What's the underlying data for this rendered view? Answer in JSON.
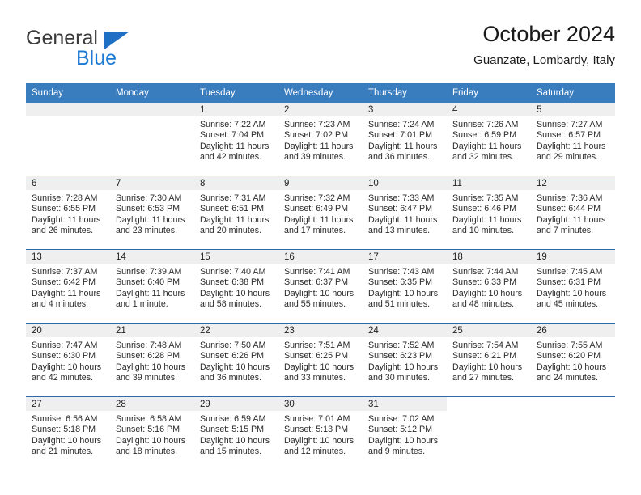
{
  "brand": {
    "name_top": "General",
    "name_bottom": "Blue",
    "accent_color": "#1c7ad4",
    "triangle_color": "#1f6fc4"
  },
  "header": {
    "title": "October 2024",
    "subtitle": "Guanzate, Lombardy, Italy"
  },
  "theme": {
    "header_row_color": "#3a7dbf",
    "row_divider_color": "#2a6ca8",
    "date_band_color": "#efefef"
  },
  "weekday_headers": [
    "Sunday",
    "Monday",
    "Tuesday",
    "Wednesday",
    "Thursday",
    "Friday",
    "Saturday"
  ],
  "weeks": [
    [
      {
        "date": "",
        "type": "blank",
        "sunrise": "",
        "sunset": "",
        "daylight_1": "",
        "daylight_2": ""
      },
      {
        "date": "",
        "type": "blank",
        "sunrise": "",
        "sunset": "",
        "daylight_1": "",
        "daylight_2": ""
      },
      {
        "date": "1",
        "type": "filled",
        "sunrise": "Sunrise: 7:22 AM",
        "sunset": "Sunset: 7:04 PM",
        "daylight_1": "Daylight: 11 hours",
        "daylight_2": "and 42 minutes."
      },
      {
        "date": "2",
        "type": "filled",
        "sunrise": "Sunrise: 7:23 AM",
        "sunset": "Sunset: 7:02 PM",
        "daylight_1": "Daylight: 11 hours",
        "daylight_2": "and 39 minutes."
      },
      {
        "date": "3",
        "type": "filled",
        "sunrise": "Sunrise: 7:24 AM",
        "sunset": "Sunset: 7:01 PM",
        "daylight_1": "Daylight: 11 hours",
        "daylight_2": "and 36 minutes."
      },
      {
        "date": "4",
        "type": "filled",
        "sunrise": "Sunrise: 7:26 AM",
        "sunset": "Sunset: 6:59 PM",
        "daylight_1": "Daylight: 11 hours",
        "daylight_2": "and 32 minutes."
      },
      {
        "date": "5",
        "type": "filled",
        "sunrise": "Sunrise: 7:27 AM",
        "sunset": "Sunset: 6:57 PM",
        "daylight_1": "Daylight: 11 hours",
        "daylight_2": "and 29 minutes."
      }
    ],
    [
      {
        "date": "6",
        "type": "filled",
        "sunrise": "Sunrise: 7:28 AM",
        "sunset": "Sunset: 6:55 PM",
        "daylight_1": "Daylight: 11 hours",
        "daylight_2": "and 26 minutes."
      },
      {
        "date": "7",
        "type": "filled",
        "sunrise": "Sunrise: 7:30 AM",
        "sunset": "Sunset: 6:53 PM",
        "daylight_1": "Daylight: 11 hours",
        "daylight_2": "and 23 minutes."
      },
      {
        "date": "8",
        "type": "filled",
        "sunrise": "Sunrise: 7:31 AM",
        "sunset": "Sunset: 6:51 PM",
        "daylight_1": "Daylight: 11 hours",
        "daylight_2": "and 20 minutes."
      },
      {
        "date": "9",
        "type": "filled",
        "sunrise": "Sunrise: 7:32 AM",
        "sunset": "Sunset: 6:49 PM",
        "daylight_1": "Daylight: 11 hours",
        "daylight_2": "and 17 minutes."
      },
      {
        "date": "10",
        "type": "filled",
        "sunrise": "Sunrise: 7:33 AM",
        "sunset": "Sunset: 6:47 PM",
        "daylight_1": "Daylight: 11 hours",
        "daylight_2": "and 13 minutes."
      },
      {
        "date": "11",
        "type": "filled",
        "sunrise": "Sunrise: 7:35 AM",
        "sunset": "Sunset: 6:46 PM",
        "daylight_1": "Daylight: 11 hours",
        "daylight_2": "and 10 minutes."
      },
      {
        "date": "12",
        "type": "filled",
        "sunrise": "Sunrise: 7:36 AM",
        "sunset": "Sunset: 6:44 PM",
        "daylight_1": "Daylight: 11 hours",
        "daylight_2": "and 7 minutes."
      }
    ],
    [
      {
        "date": "13",
        "type": "filled",
        "sunrise": "Sunrise: 7:37 AM",
        "sunset": "Sunset: 6:42 PM",
        "daylight_1": "Daylight: 11 hours",
        "daylight_2": "and 4 minutes."
      },
      {
        "date": "14",
        "type": "filled",
        "sunrise": "Sunrise: 7:39 AM",
        "sunset": "Sunset: 6:40 PM",
        "daylight_1": "Daylight: 11 hours",
        "daylight_2": "and 1 minute."
      },
      {
        "date": "15",
        "type": "filled",
        "sunrise": "Sunrise: 7:40 AM",
        "sunset": "Sunset: 6:38 PM",
        "daylight_1": "Daylight: 10 hours",
        "daylight_2": "and 58 minutes."
      },
      {
        "date": "16",
        "type": "filled",
        "sunrise": "Sunrise: 7:41 AM",
        "sunset": "Sunset: 6:37 PM",
        "daylight_1": "Daylight: 10 hours",
        "daylight_2": "and 55 minutes."
      },
      {
        "date": "17",
        "type": "filled",
        "sunrise": "Sunrise: 7:43 AM",
        "sunset": "Sunset: 6:35 PM",
        "daylight_1": "Daylight: 10 hours",
        "daylight_2": "and 51 minutes."
      },
      {
        "date": "18",
        "type": "filled",
        "sunrise": "Sunrise: 7:44 AM",
        "sunset": "Sunset: 6:33 PM",
        "daylight_1": "Daylight: 10 hours",
        "daylight_2": "and 48 minutes."
      },
      {
        "date": "19",
        "type": "filled",
        "sunrise": "Sunrise: 7:45 AM",
        "sunset": "Sunset: 6:31 PM",
        "daylight_1": "Daylight: 10 hours",
        "daylight_2": "and 45 minutes."
      }
    ],
    [
      {
        "date": "20",
        "type": "filled",
        "sunrise": "Sunrise: 7:47 AM",
        "sunset": "Sunset: 6:30 PM",
        "daylight_1": "Daylight: 10 hours",
        "daylight_2": "and 42 minutes."
      },
      {
        "date": "21",
        "type": "filled",
        "sunrise": "Sunrise: 7:48 AM",
        "sunset": "Sunset: 6:28 PM",
        "daylight_1": "Daylight: 10 hours",
        "daylight_2": "and 39 minutes."
      },
      {
        "date": "22",
        "type": "filled",
        "sunrise": "Sunrise: 7:50 AM",
        "sunset": "Sunset: 6:26 PM",
        "daylight_1": "Daylight: 10 hours",
        "daylight_2": "and 36 minutes."
      },
      {
        "date": "23",
        "type": "filled",
        "sunrise": "Sunrise: 7:51 AM",
        "sunset": "Sunset: 6:25 PM",
        "daylight_1": "Daylight: 10 hours",
        "daylight_2": "and 33 minutes."
      },
      {
        "date": "24",
        "type": "filled",
        "sunrise": "Sunrise: 7:52 AM",
        "sunset": "Sunset: 6:23 PM",
        "daylight_1": "Daylight: 10 hours",
        "daylight_2": "and 30 minutes."
      },
      {
        "date": "25",
        "type": "filled",
        "sunrise": "Sunrise: 7:54 AM",
        "sunset": "Sunset: 6:21 PM",
        "daylight_1": "Daylight: 10 hours",
        "daylight_2": "and 27 minutes."
      },
      {
        "date": "26",
        "type": "filled",
        "sunrise": "Sunrise: 7:55 AM",
        "sunset": "Sunset: 6:20 PM",
        "daylight_1": "Daylight: 10 hours",
        "daylight_2": "and 24 minutes."
      }
    ],
    [
      {
        "date": "27",
        "type": "filled",
        "sunrise": "Sunrise: 6:56 AM",
        "sunset": "Sunset: 5:18 PM",
        "daylight_1": "Daylight: 10 hours",
        "daylight_2": "and 21 minutes."
      },
      {
        "date": "28",
        "type": "filled",
        "sunrise": "Sunrise: 6:58 AM",
        "sunset": "Sunset: 5:16 PM",
        "daylight_1": "Daylight: 10 hours",
        "daylight_2": "and 18 minutes."
      },
      {
        "date": "29",
        "type": "filled",
        "sunrise": "Sunrise: 6:59 AM",
        "sunset": "Sunset: 5:15 PM",
        "daylight_1": "Daylight: 10 hours",
        "daylight_2": "and 15 minutes."
      },
      {
        "date": "30",
        "type": "filled",
        "sunrise": "Sunrise: 7:01 AM",
        "sunset": "Sunset: 5:13 PM",
        "daylight_1": "Daylight: 10 hours",
        "daylight_2": "and 12 minutes."
      },
      {
        "date": "31",
        "type": "filled",
        "sunrise": "Sunrise: 7:02 AM",
        "sunset": "Sunset: 5:12 PM",
        "daylight_1": "Daylight: 10 hours",
        "daylight_2": "and 9 minutes."
      },
      {
        "date": "",
        "type": "empty",
        "sunrise": "",
        "sunset": "",
        "daylight_1": "",
        "daylight_2": ""
      },
      {
        "date": "",
        "type": "empty",
        "sunrise": "",
        "sunset": "",
        "daylight_1": "",
        "daylight_2": ""
      }
    ]
  ]
}
